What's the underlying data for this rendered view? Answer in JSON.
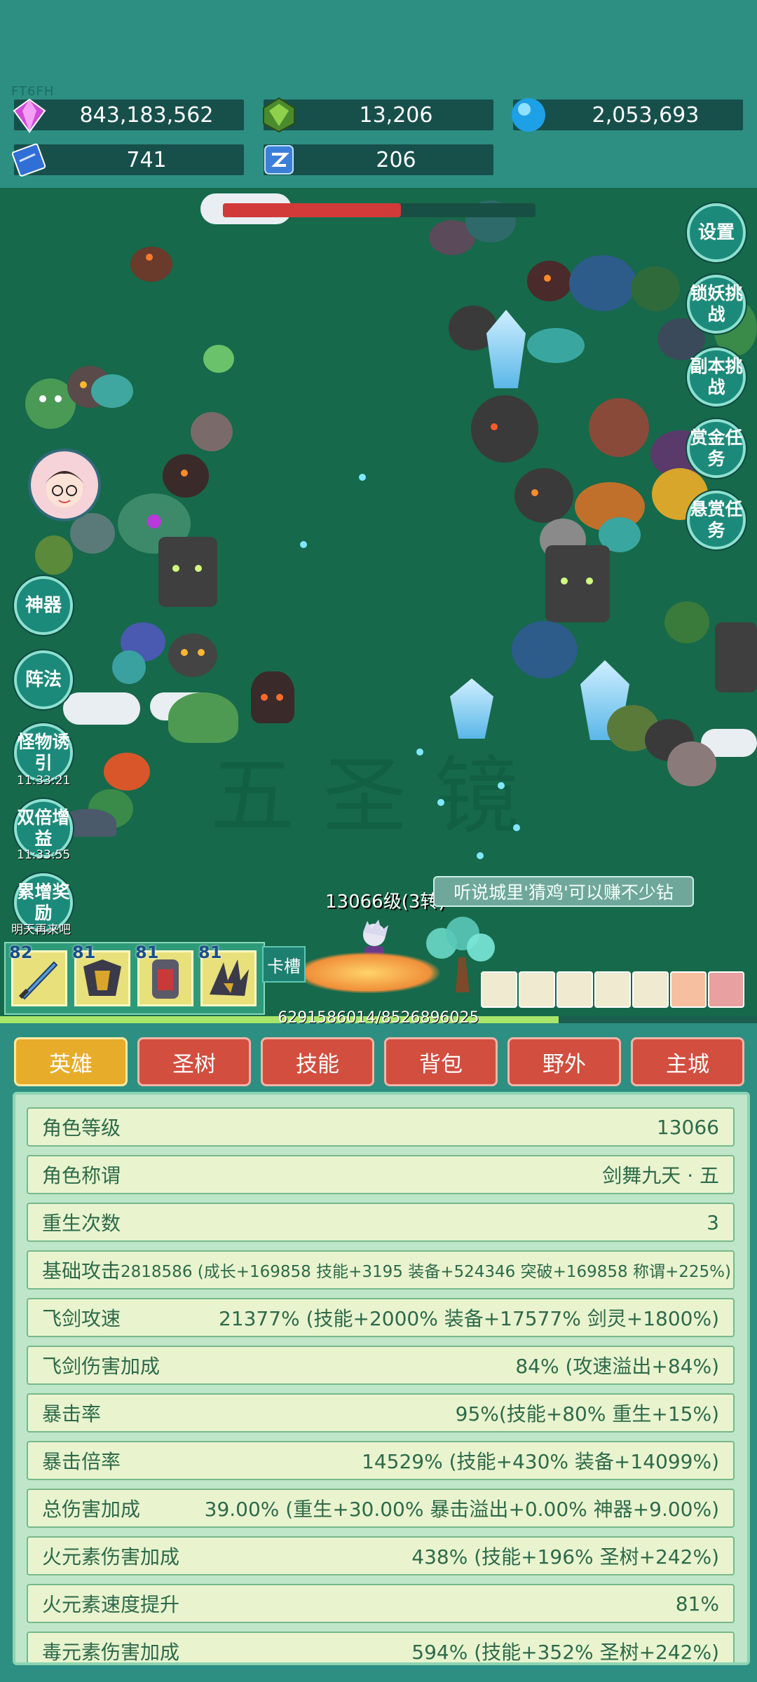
{
  "watermark": "FT6FH",
  "resources": [
    {
      "icon": "pink-gem-icon",
      "value": "843,183,562"
    },
    {
      "icon": "green-gem-icon",
      "value": "13,206"
    },
    {
      "icon": "blue-orb-icon",
      "value": "2,053,693"
    },
    {
      "icon": "blue-book-icon",
      "value": "741"
    },
    {
      "icon": "blue-rune-icon",
      "value": "206"
    }
  ],
  "right_buttons": [
    "设置",
    "锁妖挑战",
    "副本挑战",
    "赏金任务",
    "悬赏任务"
  ],
  "left_buttons": [
    {
      "label": "神器"
    },
    {
      "label": "阵法"
    },
    {
      "label": "怪物诱引",
      "timer": "11:33:21"
    },
    {
      "label": "双倍增益",
      "timer": "11:33:55"
    },
    {
      "label": "累增奖励",
      "note": "明天再来吧"
    }
  ],
  "field_watermark": "五圣镜",
  "hero": {
    "level_label": "13066级(3转)",
    "exp_text": "6291586014/8526896025",
    "exp_fraction": 0.738
  },
  "chat_bubble": "听说城里'猜鸡'可以赚不少钻",
  "boss_hp_fraction": 0.57,
  "skill_slots": [
    {
      "level": "82",
      "icon": "sword-icon"
    },
    {
      "level": "81",
      "icon": "armor-icon"
    },
    {
      "level": "81",
      "icon": "knight-icon"
    },
    {
      "level": "81",
      "icon": "claw-icon"
    }
  ],
  "card_slot_label": "卡槽",
  "tabs": [
    {
      "label": "英雄",
      "active": true
    },
    {
      "label": "圣树",
      "active": false
    },
    {
      "label": "技能",
      "active": false
    },
    {
      "label": "背包",
      "active": false
    },
    {
      "label": "野外",
      "active": false
    },
    {
      "label": "主城",
      "active": false
    }
  ],
  "stats": [
    {
      "key": "角色等级",
      "value": "13066"
    },
    {
      "key": "角色称谓",
      "value": "剑舞九天 · 五"
    },
    {
      "key": "重生次数",
      "value": "3"
    },
    {
      "key": "基础攻击",
      "value": "2818586 (成长+169858 技能+3195 装备+524346 突破+169858 称谓+225%)"
    },
    {
      "key": "飞剑攻速",
      "value": "21377% (技能+2000% 装备+17577% 剑灵+1800%)"
    },
    {
      "key": "飞剑伤害加成",
      "value": "84% (攻速溢出+84%)"
    },
    {
      "key": "暴击率",
      "value": "95%(技能+80% 重生+15%)"
    },
    {
      "key": "暴击倍率",
      "value": "14529% (技能+430% 装备+14099%)"
    },
    {
      "key": "总伤害加成",
      "value": "39.00% (重生+30.00% 暴击溢出+0.00% 神器+9.00%)"
    },
    {
      "key": "火元素伤害加成",
      "value": "438% (技能+196% 圣树+242%)"
    },
    {
      "key": "火元素速度提升",
      "value": "81%"
    },
    {
      "key": "毒元素伤害加成",
      "value": "594% (技能+352% 圣树+242%)"
    }
  ]
}
